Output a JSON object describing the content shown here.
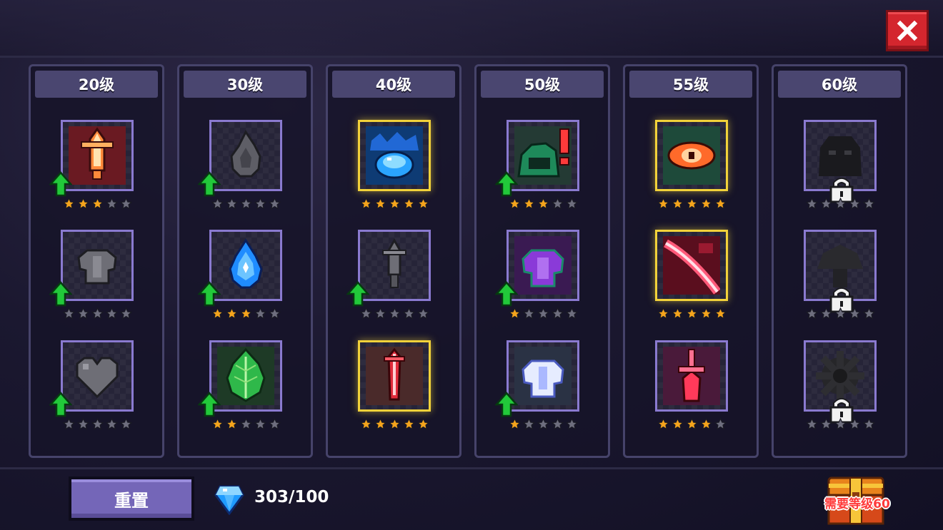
{
  "close_icon": "close-x-icon",
  "columns": [
    {
      "label": "20级",
      "slots": [
        {
          "icon": "orange-sword-icon",
          "stars": 3,
          "gold": false,
          "upgrade": true,
          "locked": false
        },
        {
          "icon": "grey-armor-icon",
          "stars": 0,
          "gold": false,
          "upgrade": true,
          "locked": false
        },
        {
          "icon": "grey-heart-icon",
          "stars": 0,
          "gold": false,
          "upgrade": true,
          "locked": false
        }
      ]
    },
    {
      "label": "30级",
      "slots": [
        {
          "icon": "grey-flame-icon",
          "stars": 0,
          "gold": false,
          "upgrade": true,
          "locked": false
        },
        {
          "icon": "blue-droplet-icon",
          "stars": 3,
          "gold": false,
          "upgrade": true,
          "locked": false
        },
        {
          "icon": "green-leaf-icon",
          "stars": 2,
          "gold": false,
          "upgrade": true,
          "locked": false
        }
      ]
    },
    {
      "label": "40级",
      "slots": [
        {
          "icon": "blue-slime-icon",
          "stars": 5,
          "gold": true,
          "upgrade": false,
          "locked": false
        },
        {
          "icon": "grey-dagger-icon",
          "stars": 0,
          "gold": false,
          "upgrade": true,
          "locked": false
        },
        {
          "icon": "red-sword-icon",
          "stars": 5,
          "gold": true,
          "upgrade": false,
          "locked": false
        }
      ]
    },
    {
      "label": "50级",
      "slots": [
        {
          "icon": "green-hooded-alert-icon",
          "stars": 3,
          "gold": false,
          "upgrade": true,
          "locked": false
        },
        {
          "icon": "purple-armor-icon",
          "stars": 1,
          "gold": false,
          "upgrade": true,
          "locked": false
        },
        {
          "icon": "white-armor-icon",
          "stars": 1,
          "gold": false,
          "upgrade": true,
          "locked": false
        }
      ]
    },
    {
      "label": "55级",
      "slots": [
        {
          "icon": "red-eye-icon",
          "stars": 5,
          "gold": true,
          "upgrade": false,
          "locked": false
        },
        {
          "icon": "crimson-slash-icon",
          "stars": 5,
          "gold": true,
          "upgrade": false,
          "locked": false
        },
        {
          "icon": "pink-dagger-icon",
          "stars": 4,
          "gold": false,
          "upgrade": false,
          "locked": false
        }
      ]
    },
    {
      "label": "60级",
      "slots": [
        {
          "icon": "shadow-creature-icon",
          "stars": 0,
          "gold": false,
          "upgrade": false,
          "locked": true
        },
        {
          "icon": "shadow-mushroom-icon",
          "stars": 0,
          "gold": false,
          "upgrade": false,
          "locked": true
        },
        {
          "icon": "shadow-gear-icon",
          "stars": 0,
          "gold": false,
          "upgrade": false,
          "locked": true
        }
      ]
    }
  ],
  "max_stars": 5,
  "footer": {
    "reset_label": "重置",
    "gem_icon": "blue-diamond-icon",
    "gem_count": "303/100",
    "chest_icon": "treasure-chest-icon",
    "chest_label": "需要等级60"
  },
  "colors": {
    "star_active": "#f4a41c",
    "star_inactive": "#6e6e7e",
    "slot_border": "#8a7ad0",
    "slot_border_gold": "#f2d23a",
    "upgrade_arrow": "#22c93a",
    "close_button": "#d4262e",
    "reset_button": "#7466b8"
  }
}
